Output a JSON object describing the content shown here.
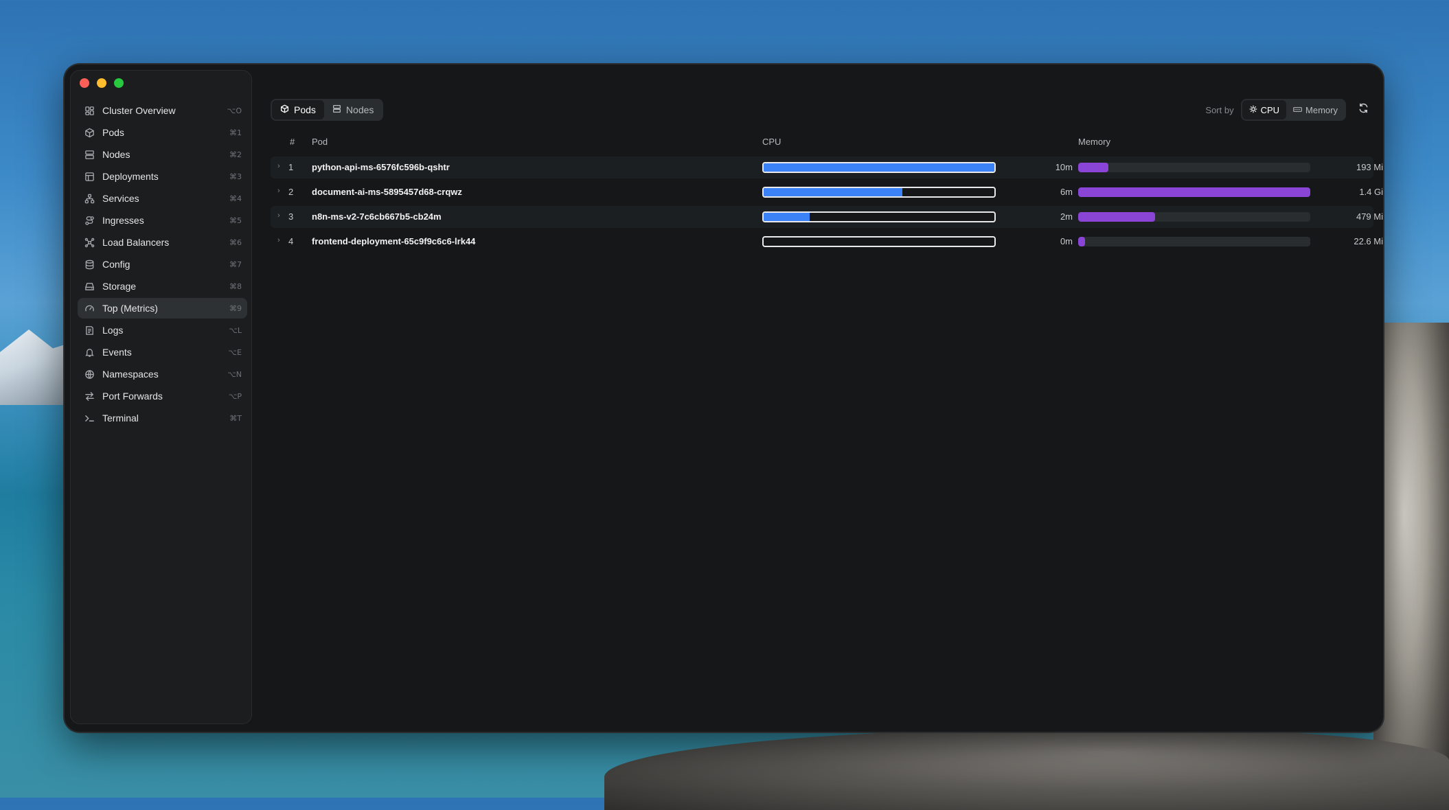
{
  "sidebar": {
    "items": [
      {
        "label": "Cluster Overview",
        "shortcut": "⌥O",
        "icon": "dashboard-icon"
      },
      {
        "label": "Pods",
        "shortcut": "⌘1",
        "icon": "cube-icon"
      },
      {
        "label": "Nodes",
        "shortcut": "⌘2",
        "icon": "server-icon"
      },
      {
        "label": "Deployments",
        "shortcut": "⌘3",
        "icon": "layout-icon"
      },
      {
        "label": "Services",
        "shortcut": "⌘4",
        "icon": "network-icon"
      },
      {
        "label": "Ingresses",
        "shortcut": "⌘5",
        "icon": "route-icon"
      },
      {
        "label": "Load Balancers",
        "shortcut": "⌘6",
        "icon": "scale-icon"
      },
      {
        "label": "Config",
        "shortcut": "⌘7",
        "icon": "database-icon"
      },
      {
        "label": "Storage",
        "shortcut": "⌘8",
        "icon": "hard-drive-icon"
      },
      {
        "label": "Top (Metrics)",
        "shortcut": "⌘9",
        "icon": "gauge-icon",
        "active": true
      },
      {
        "label": "Logs",
        "shortcut": "⌥L",
        "icon": "logs-icon"
      },
      {
        "label": "Events",
        "shortcut": "⌥E",
        "icon": "bell-icon"
      },
      {
        "label": "Namespaces",
        "shortcut": "⌥N",
        "icon": "globe-icon"
      },
      {
        "label": "Port Forwards",
        "shortcut": "⌥P",
        "icon": "arrows-icon"
      },
      {
        "label": "Terminal",
        "shortcut": "⌘T",
        "icon": "terminal-icon"
      }
    ]
  },
  "view_toggle": {
    "pods": "Pods",
    "nodes": "Nodes",
    "selected": "Pods"
  },
  "sort": {
    "label": "Sort by",
    "cpu": "CPU",
    "memory": "Memory",
    "selected": "CPU"
  },
  "table": {
    "headers": {
      "num": "#",
      "pod": "Pod",
      "cpu": "CPU",
      "memory": "Memory"
    },
    "rows": [
      {
        "num": "1",
        "pod": "python-api-ms-6576fc596b-qshtr",
        "cpu": "10m",
        "cpu_fraction": 1.0,
        "memory": "193 Mi",
        "mem_fraction": 0.13
      },
      {
        "num": "2",
        "pod": "document-ai-ms-5895457d68-crqwz",
        "cpu": "6m",
        "cpu_fraction": 0.6,
        "memory": "1.4 Gi",
        "mem_fraction": 1.0
      },
      {
        "num": "3",
        "pod": "n8n-ms-v2-7c6cb667b5-cb24m",
        "cpu": "2m",
        "cpu_fraction": 0.2,
        "memory": "479 Mi",
        "mem_fraction": 0.33
      },
      {
        "num": "4",
        "pod": "frontend-deployment-65c9f9c6c6-lrk44",
        "cpu": "0m",
        "cpu_fraction": 0.0,
        "memory": "22.6 Mi",
        "mem_fraction": 0.03
      }
    ]
  },
  "colors": {
    "cpu_bar": "#3b82f6",
    "memory_bar": "#8b45d6"
  }
}
